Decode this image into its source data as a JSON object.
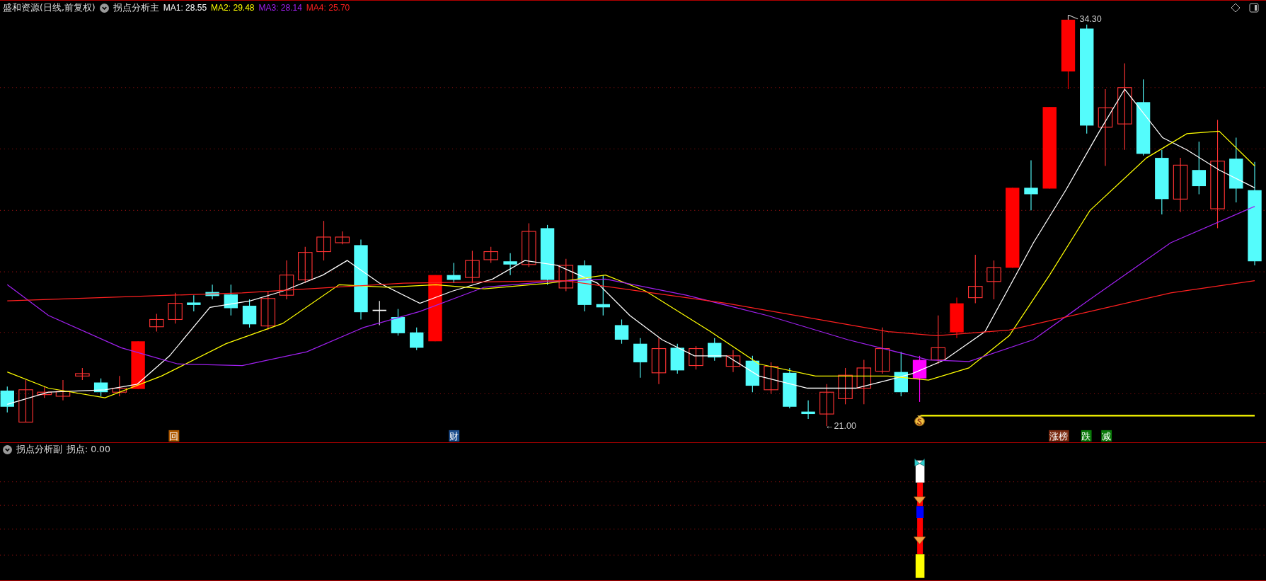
{
  "main_panel": {
    "stock_title": "盛和资源(日线,前复权)",
    "indicator_name": "拐点分析主",
    "moving_averages": [
      {
        "label": "MA1: 28.55",
        "color": "#ffffff"
      },
      {
        "label": "MA2: 29.48",
        "color": "#ffff00"
      },
      {
        "label": "MA3: 28.14",
        "color": "#a020f0"
      },
      {
        "label": "MA4: 25.70",
        "color": "#ff2020"
      }
    ],
    "high_marker": "34.30",
    "low_marker": "←21.00",
    "signal_tags": [
      {
        "text": "回",
        "color": "#b05a00"
      },
      {
        "text": "财",
        "color": "#1d4f8f"
      },
      {
        "text": "涨榜",
        "color": "#7a2a10"
      },
      {
        "text": "跌",
        "color": "#0a7a0a"
      },
      {
        "text": "减",
        "color": "#0a7a0a"
      }
    ]
  },
  "sub_panel": {
    "indicator_name": "拐点分析副",
    "reading": "拐点: 0.00"
  }
}
